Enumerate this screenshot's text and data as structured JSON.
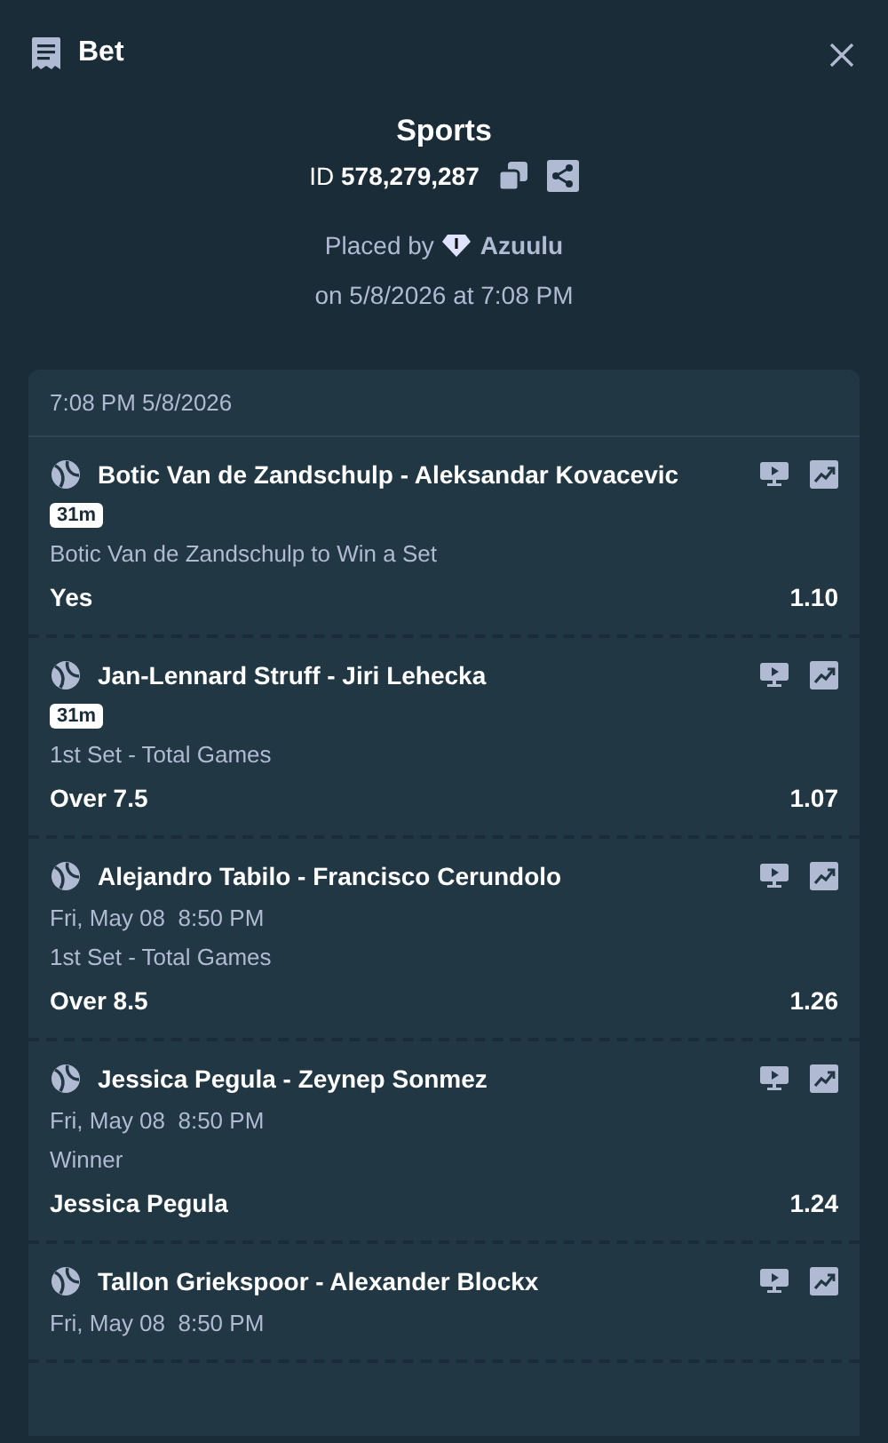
{
  "header": {
    "title": "Bet"
  },
  "summary": {
    "category": "Sports",
    "id_label": "ID",
    "id_value": "578,279,287",
    "placed_by": "Placed by",
    "user": "Azuulu",
    "placed_on": "on 5/8/2026 at 7:08 PM"
  },
  "slip": {
    "timestamp": "7:08 PM 5/8/2026",
    "legs": [
      {
        "kind": "live",
        "event": "Botic Van de Zandschulp - Aleksandar Kovacevic",
        "badge": "31m",
        "market": "Botic Van de Zandschulp to Win a Set",
        "selection": "Yes",
        "odds": "1.10"
      },
      {
        "kind": "live",
        "event": "Jan-Lennard Struff - Jiri Lehecka",
        "badge": "31m",
        "market": "1st Set - Total Games",
        "selection": "Over 7.5",
        "odds": "1.07"
      },
      {
        "kind": "scheduled",
        "event": "Alejandro Tabilo - Francisco Cerundolo",
        "start": "Fri, May 08  8:50 PM",
        "market": "1st Set - Total Games",
        "selection": "Over 8.5",
        "odds": "1.26"
      },
      {
        "kind": "scheduled",
        "event": "Jessica Pegula - Zeynep Sonmez",
        "start": "Fri, May 08  8:50 PM",
        "market": "Winner",
        "selection": "Jessica Pegula",
        "odds": "1.24"
      },
      {
        "kind": "scheduled",
        "event": "Tallon Griekspoor - Alexander Blockx",
        "start": "Fri, May 08  8:50 PM"
      }
    ]
  }
}
